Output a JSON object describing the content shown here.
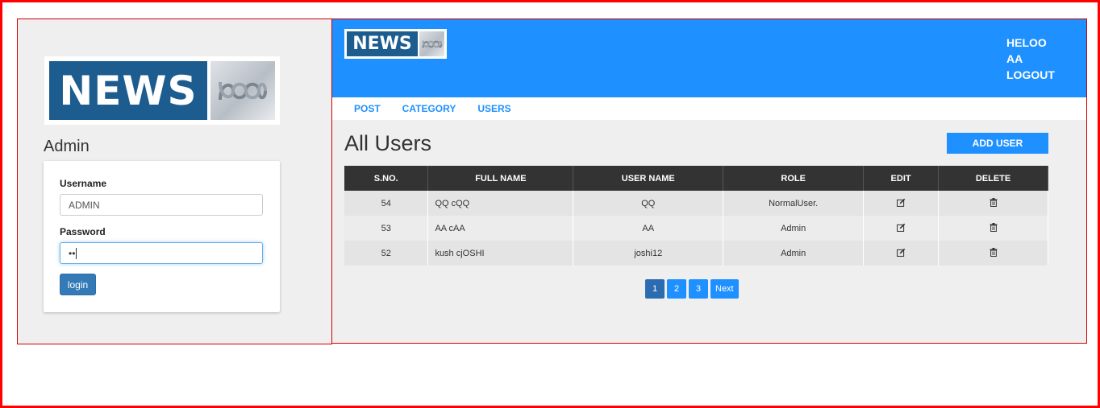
{
  "login": {
    "logo_text": "NEWS",
    "title": "Admin",
    "username_label": "Username",
    "username_value": "ADMIN",
    "password_label": "Password",
    "password_value": "••",
    "submit_label": "login"
  },
  "header": {
    "logo_text": "NEWS",
    "greeting": "HELOO",
    "username": "AA",
    "logout_label": "LOGOUT"
  },
  "nav": {
    "items": [
      {
        "label": "POST"
      },
      {
        "label": "CATEGORY"
      },
      {
        "label": "USERS"
      }
    ]
  },
  "main": {
    "title": "All Users",
    "add_button_label": "ADD USER",
    "columns": [
      "S.NO.",
      "FULL NAME",
      "USER NAME",
      "ROLE",
      "EDIT",
      "DELETE"
    ],
    "rows": [
      {
        "sno": "54",
        "full_name": "QQ cQQ",
        "user_name": "QQ",
        "role": "NormalUser.",
        "edit_icon": "edit-icon",
        "delete_icon": "trash-icon"
      },
      {
        "sno": "53",
        "full_name": "AA cAA",
        "user_name": "AA",
        "role": "Admin",
        "edit_icon": "edit-icon",
        "delete_icon": "trash-icon"
      },
      {
        "sno": "52",
        "full_name": "kush cjOSHI",
        "user_name": "joshi12",
        "role": "Admin",
        "edit_icon": "edit-icon",
        "delete_icon": "trash-icon"
      }
    ],
    "pagination": {
      "pages": [
        "1",
        "2",
        "3"
      ],
      "current": "1",
      "next_label": "Next"
    }
  },
  "colors": {
    "header_blue": "#1e90ff",
    "logo_blue": "#1c5c8f",
    "frame_red": "#ff0000",
    "table_header": "#333333",
    "login_button": "#337ab7"
  }
}
